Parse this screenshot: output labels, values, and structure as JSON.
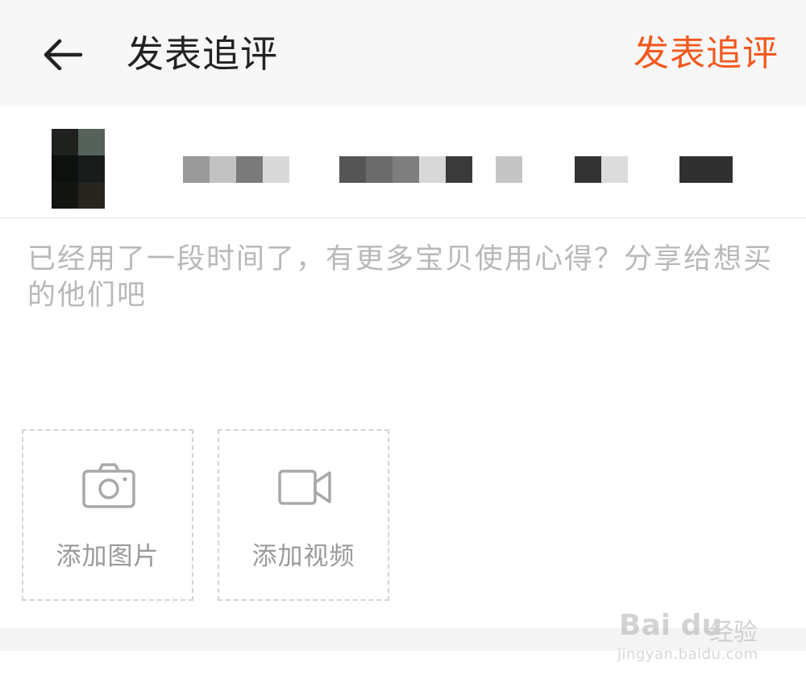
{
  "header": {
    "title": "发表追评",
    "submit_label": "发表追评"
  },
  "comment": {
    "placeholder": "已经用了一段时间了，有更多宝贝使用心得？分享给想买的他们吧"
  },
  "uploads": {
    "add_photo_label": "添加图片",
    "add_video_label": "添加视频"
  },
  "watermark": {
    "logo": "Bai du",
    "suffix": "经验",
    "url": "jingyan.baidu.com"
  },
  "colors": {
    "accent": "#f2581e",
    "title": "#222222",
    "placeholder": "#b8b8b8",
    "header_bg": "#f7f7f7"
  },
  "icons": {
    "back": "arrow-left-icon",
    "photo": "camera-icon",
    "video": "video-camera-icon"
  }
}
